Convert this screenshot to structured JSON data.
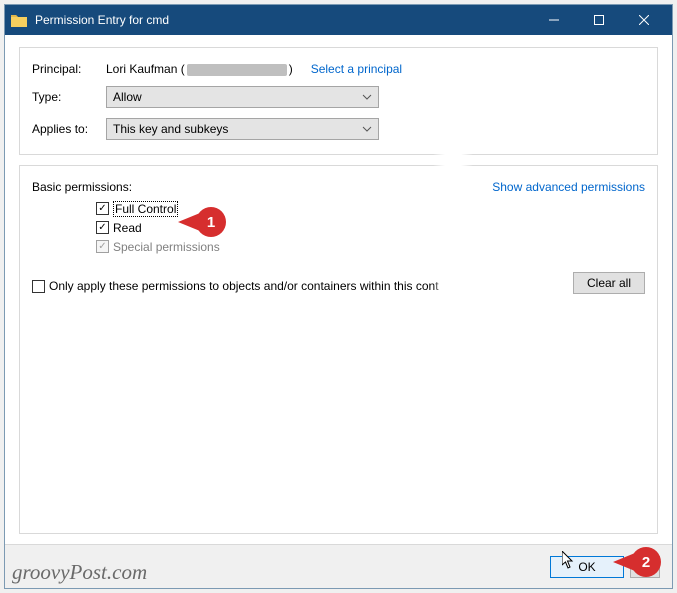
{
  "titlebar": {
    "title": "Permission Entry for cmd"
  },
  "labels": {
    "principal": "Principal:",
    "type": "Type:",
    "applies_to": "Applies to:",
    "basic_permissions": "Basic permissions:",
    "show_advanced": "Show advanced permissions",
    "only_apply": "Only apply these permissions to objects and/or containers within this cont",
    "clear_all": "Clear all",
    "ok": "OK",
    "select_principal": "Select a principal"
  },
  "principal": {
    "name_prefix": "Lori Kaufman (",
    "name_suffix": ")"
  },
  "dropdowns": {
    "type_value": "Allow",
    "applies_value": "This key and subkeys"
  },
  "permissions": [
    {
      "label": "Full Control",
      "checked": true,
      "disabled": false,
      "focus": true
    },
    {
      "label": "Read",
      "checked": true,
      "disabled": false,
      "focus": false
    },
    {
      "label": "Special permissions",
      "checked": true,
      "disabled": true,
      "focus": false
    }
  ],
  "callouts": {
    "one": "1",
    "two": "2"
  },
  "watermark": "groovyPost.com"
}
